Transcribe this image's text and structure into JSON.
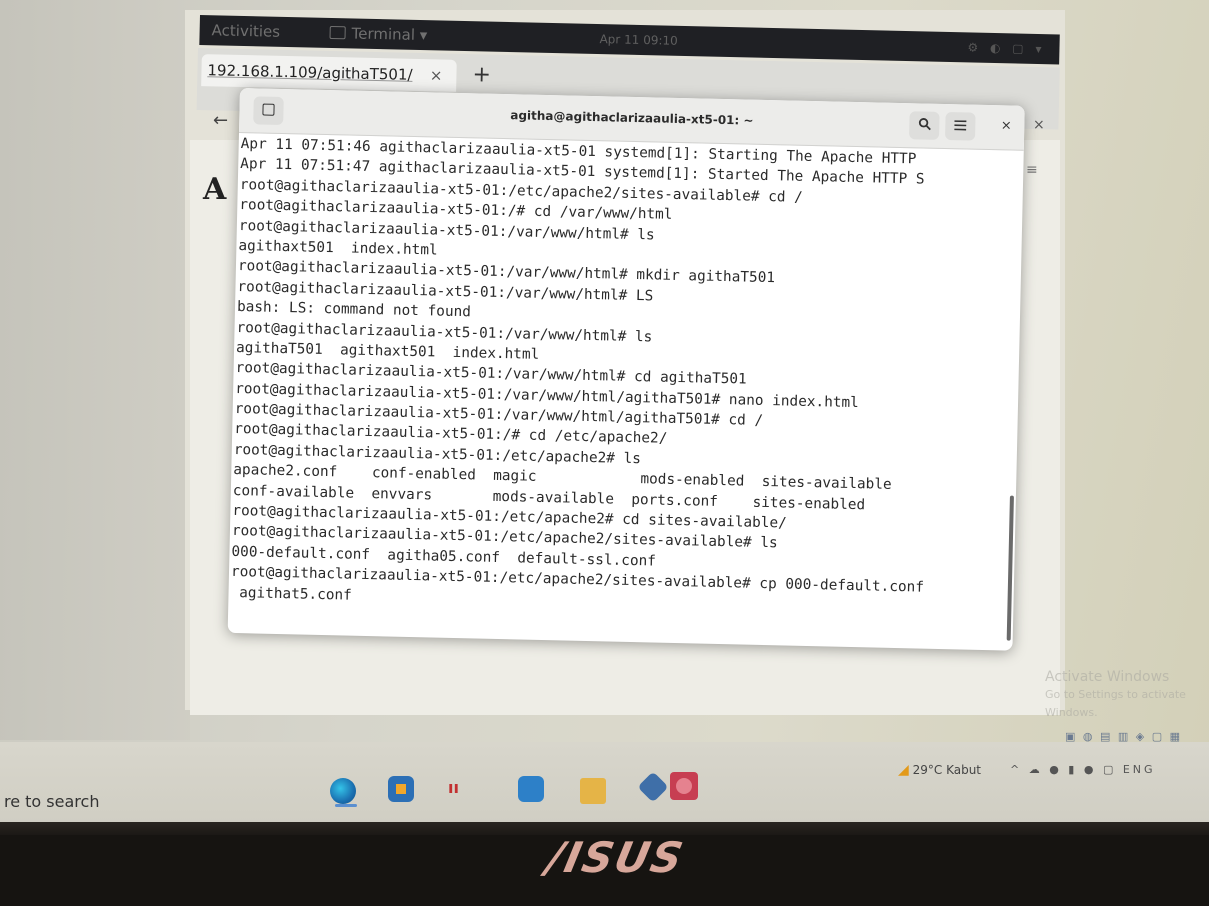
{
  "gnome": {
    "activities": "Activities",
    "app_menu": "Terminal ▾",
    "clock": "Apr 11 09:10"
  },
  "browser": {
    "tab_url": "192.168.1.109/agithaT501/",
    "tab_close": "×",
    "new_tab": "+",
    "back": "←",
    "page_heading_initial": "A"
  },
  "terminal": {
    "title": "agitha@agithaclarizaaulia-xt5-01: ~",
    "search_icon": "search-icon",
    "menu_icon": "hamburger-menu-icon",
    "close_label": "×",
    "lines": [
      "Apr 11 07:51:46 agithaclarizaaulia-xt5-01 systemd[1]: Starting The Apache HTTP",
      "Apr 11 07:51:47 agithaclarizaaulia-xt5-01 systemd[1]: Started The Apache HTTP S",
      "root@agithaclarizaaulia-xt5-01:/etc/apache2/sites-available# cd /",
      "root@agithaclarizaaulia-xt5-01:/# cd /var/www/html",
      "root@agithaclarizaaulia-xt5-01:/var/www/html# ls",
      "agithaxt501  index.html",
      "root@agithaclarizaaulia-xt5-01:/var/www/html# mkdir agithaT501",
      "root@agithaclarizaaulia-xt5-01:/var/www/html# LS",
      "bash: LS: command not found",
      "root@agithaclarizaaulia-xt5-01:/var/www/html# ls",
      "agithaT501  agithaxt501  index.html",
      "root@agithaclarizaaulia-xt5-01:/var/www/html# cd agithaT501",
      "root@agithaclarizaaulia-xt5-01:/var/www/html/agithaT501# nano index.html",
      "root@agithaclarizaaulia-xt5-01:/var/www/html/agithaT501# cd /",
      "root@agithaclarizaaulia-xt5-01:/# cd /etc/apache2/",
      "root@agithaclarizaaulia-xt5-01:/etc/apache2# ls",
      "apache2.conf    conf-enabled  magic            mods-enabled  sites-available",
      "conf-available  envvars       mods-available  ports.conf    sites-enabled",
      "root@agithaclarizaaulia-xt5-01:/etc/apache2# cd sites-available/",
      "root@agithaclarizaaulia-xt5-01:/etc/apache2/sites-available# ls",
      "000-default.conf  agitha05.conf  default-ssl.conf",
      "root@agithaclarizaaulia-xt5-01:/etc/apache2/sites-available# cp 000-default.conf",
      " agithat5.conf"
    ]
  },
  "windows": {
    "watermark_title": "Activate Windows",
    "watermark_sub": "Go to Settings to activate Windows.",
    "search_placeholder": "re to search",
    "weather": "29°C  Kabut",
    "tray_glyphs": "^ ☁ ● ▮ ● ▢",
    "language": "ENG",
    "taskbar_apps": [
      "edge-icon",
      "store-icon",
      "apps-icon",
      "mail-icon",
      "file-explorer-icon",
      "virtualbox-icon",
      "media-icon"
    ]
  },
  "laptop": {
    "brand": "/ISUS"
  }
}
